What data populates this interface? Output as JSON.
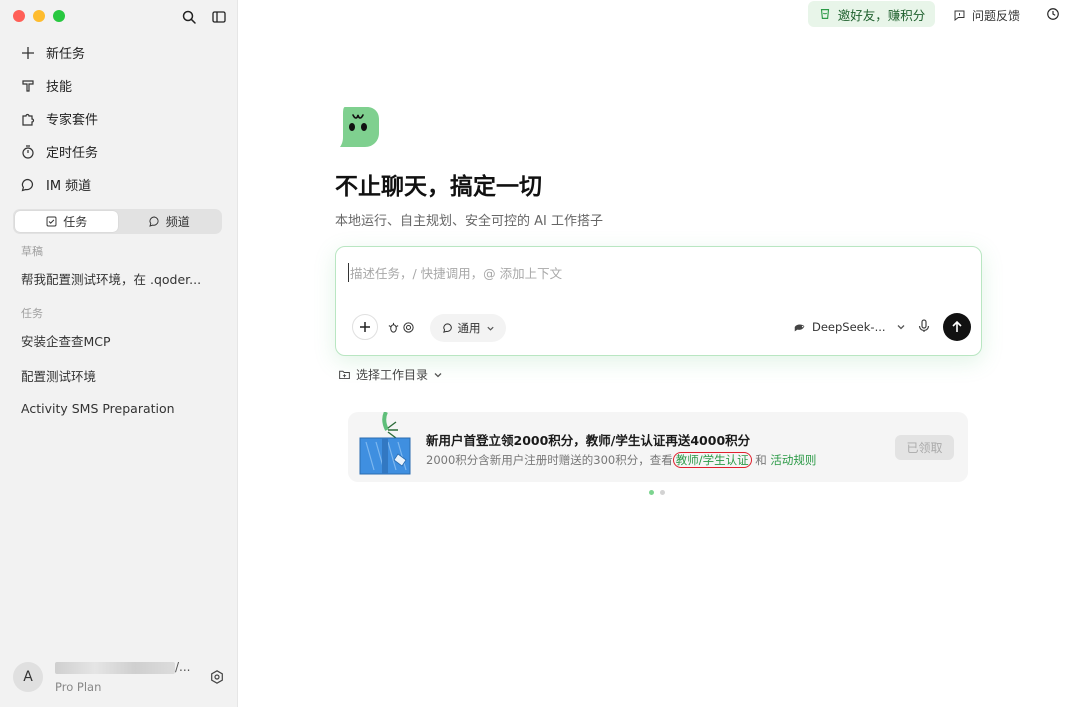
{
  "sidebar": {
    "nav": [
      {
        "label": "新任务",
        "icon": "plus-icon"
      },
      {
        "label": "技能",
        "icon": "skill-icon"
      },
      {
        "label": "专家套件",
        "icon": "puzzle-icon"
      },
      {
        "label": "定时任务",
        "icon": "timer-icon"
      },
      {
        "label": "IM 频道",
        "icon": "chat-bubble-icon"
      }
    ],
    "segments": [
      {
        "label": "任务",
        "icon": "checkbox-icon",
        "active": true
      },
      {
        "label": "频道",
        "icon": "chat-bubble-icon",
        "active": false
      }
    ],
    "drafts_heading": "草稿",
    "drafts": [
      "帮我配置测试环境，在 .qoder..."
    ],
    "tasks_heading": "任务",
    "tasks": [
      "安装企查查MCP",
      "配置测试环境",
      "Activity SMS Preparation"
    ],
    "user": {
      "avatar_letter": "A",
      "name_tail": "/...",
      "plan": "Pro Plan"
    }
  },
  "topbar": {
    "invite_label": "邀好友，赚积分",
    "feedback_label": "问题反馈"
  },
  "hero": {
    "title": "不止聊天，搞定一切",
    "subtitle": "本地运行、自主规划、安全可控的 AI 工作搭子"
  },
  "composer": {
    "placeholder": "描述任务，/ 快捷调用，@ 添加上下文",
    "mode_label": "通用",
    "model_label": "DeepSeek-..."
  },
  "workdir_label": "选择工作目录",
  "promo": {
    "title": "新用户首登立领2000积分，教师/学生认证再送4000积分",
    "desc_prefix": "2000积分含新用户注册时赠送的300积分，查看",
    "link_teacher": "教师/学生认证",
    "desc_and": " 和 ",
    "link_rules": "活动规则",
    "claimed_label": "已领取",
    "page_index": 1,
    "page_count": 2
  },
  "colors": {
    "accent_green": "#2c9a47",
    "invite_bg": "#e8f5e9",
    "highlight_red": "#e0212e"
  }
}
